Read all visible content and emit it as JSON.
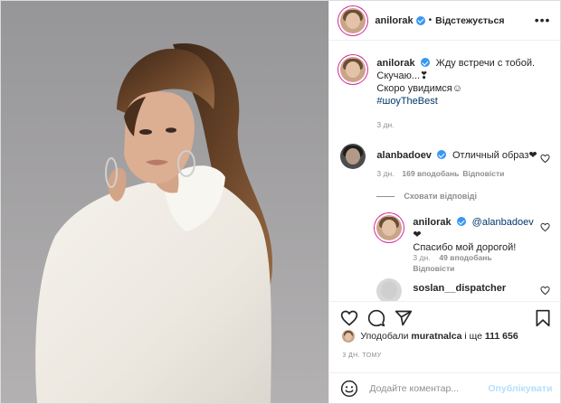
{
  "post": {
    "author": "anilorak",
    "follow_status": "Відстежується",
    "separator": "•",
    "more": "•••"
  },
  "caption": {
    "username": "anilorak",
    "line1": "Жду встречи с тобой.",
    "line2": "Скучаю...❣",
    "line3": "Скоро увидимся☺",
    "hashtag": "#шоуTheBest",
    "time": "3 дн."
  },
  "comments": [
    {
      "username": "alanbadoev",
      "text": "Отличный образ❤",
      "time": "3 дн.",
      "likes": "169 вподобань",
      "reply": "Відповісти"
    }
  ],
  "hide_replies": "Сховати відповіді",
  "replies": [
    {
      "username": "anilorak",
      "mention": "@alanbadoev",
      "text_after_mention": " ❤",
      "line2": "Спасибо мой дорогой!",
      "time": "3 дн.",
      "likes": "49 вподобань",
      "reply": "Відповісти"
    },
    {
      "username": "soslan__dispatcher"
    }
  ],
  "likes": {
    "prefix": "Уподобали",
    "user": "muratnalca",
    "middle": "і ще",
    "count": "111 656"
  },
  "date": "3 ДН. ТОМУ",
  "comment_box": {
    "placeholder": "Додайте коментар...",
    "publish": "Опублікувати"
  },
  "icons": {
    "like": "heart-icon",
    "comment": "comment-icon",
    "share": "share-icon",
    "save": "bookmark-icon",
    "emoji": "emoji-icon"
  },
  "colors": {
    "verified": "#3897f0",
    "link": "#00376b",
    "publish_disabled": "#b2dffc",
    "meta": "#8e8e8e"
  }
}
